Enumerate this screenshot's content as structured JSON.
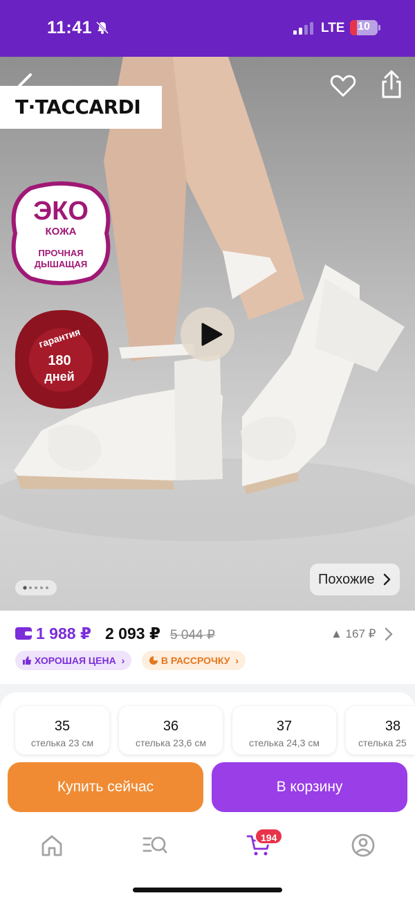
{
  "status_bar": {
    "time": "11:41",
    "network": "LTE",
    "battery": "10"
  },
  "hero": {
    "brand": "T·TACCARDI",
    "badge_eco": {
      "line1": "ЭКО",
      "line2": "КОЖА",
      "line3": "ПРОЧНАЯ",
      "line4": "ДЫШАЩАЯ"
    },
    "badge_guarantee": {
      "line1": "гарантия",
      "line2": "180",
      "line3": "дней"
    },
    "similar_label": "Похожие",
    "gallery_pages": 5,
    "gallery_active": 1
  },
  "price": {
    "wallet_price": "1 988 ₽",
    "price": "2 093 ₽",
    "old_price": "5 044 ₽",
    "price_change": "▲ 167 ₽",
    "tag_good_price": "ХОРОШАЯ ЦЕНА",
    "tag_installment": "В РАССРОЧКУ"
  },
  "sizes": [
    {
      "size": "35",
      "insole": "стелька 23 см"
    },
    {
      "size": "36",
      "insole": "стелька 23,6 см"
    },
    {
      "size": "37",
      "insole": "стелька 24,3 см"
    },
    {
      "size": "38",
      "insole": "стелька 25"
    }
  ],
  "actions": {
    "buy_now": "Купить сейчас",
    "add_to_cart": "В корзину"
  },
  "tab_bar": {
    "items": [
      {
        "icon": "home-icon"
      },
      {
        "icon": "catalog-search-icon"
      },
      {
        "icon": "cart-icon",
        "badge": "194"
      },
      {
        "icon": "profile-icon"
      }
    ]
  },
  "colors": {
    "brand_purple": "#6a22c2",
    "accent_purple": "#9a3ee8",
    "accent_orange": "#f08b33",
    "badge_red": "#e8334b"
  }
}
